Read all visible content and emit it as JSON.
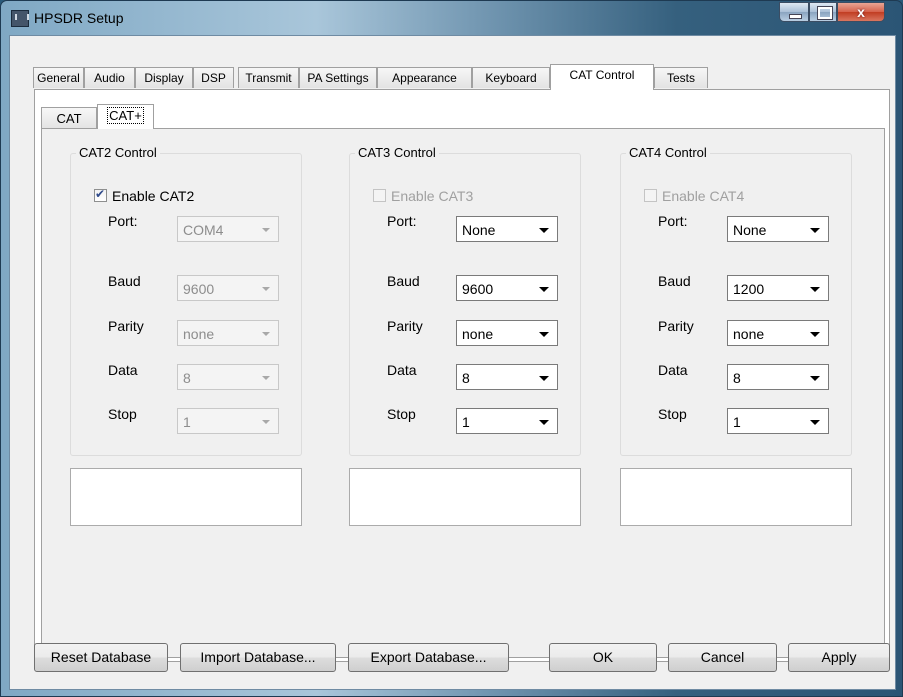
{
  "window": {
    "title": "HPSDR Setup",
    "minimize_symbol": "",
    "close_symbol": "x"
  },
  "tabs": [
    {
      "label": "General"
    },
    {
      "label": "Audio"
    },
    {
      "label": "Display"
    },
    {
      "label": "DSP"
    },
    {
      "label": "Transmit"
    },
    {
      "label": "PA Settings"
    },
    {
      "label": "Appearance"
    },
    {
      "label": "Keyboard"
    },
    {
      "label": "CAT Control",
      "active": true
    },
    {
      "label": "Tests"
    }
  ],
  "subtabs": [
    {
      "label": "CAT"
    },
    {
      "label": "CAT+",
      "active": true
    }
  ],
  "groups": [
    {
      "title": "CAT2 Control",
      "enable_label": "Enable CAT2",
      "enabled": true,
      "checked": true,
      "fields": {
        "port": {
          "label": "Port:",
          "value": "COM4"
        },
        "baud": {
          "label": "Baud",
          "value": "9600"
        },
        "parity": {
          "label": "Parity",
          "value": "none"
        },
        "data": {
          "label": "Data",
          "value": "8"
        },
        "stop": {
          "label": "Stop",
          "value": "1"
        }
      }
    },
    {
      "title": "CAT3 Control",
      "enable_label": "Enable CAT3",
      "enabled": false,
      "checked": false,
      "fields": {
        "port": {
          "label": "Port:",
          "value": "None"
        },
        "baud": {
          "label": "Baud",
          "value": "9600"
        },
        "parity": {
          "label": "Parity",
          "value": "none"
        },
        "data": {
          "label": "Data",
          "value": "8"
        },
        "stop": {
          "label": "Stop",
          "value": "1"
        }
      }
    },
    {
      "title": "CAT4 Control",
      "enable_label": "Enable CAT4",
      "enabled": false,
      "checked": false,
      "fields": {
        "port": {
          "label": "Port:",
          "value": "None"
        },
        "baud": {
          "label": "Baud",
          "value": "1200"
        },
        "parity": {
          "label": "Parity",
          "value": "none"
        },
        "data": {
          "label": "Data",
          "value": "8"
        },
        "stop": {
          "label": "Stop",
          "value": "1"
        }
      }
    }
  ],
  "buttons": {
    "reset": "Reset Database",
    "import": "Import Database...",
    "export": "Export Database...",
    "ok": "OK",
    "cancel": "Cancel",
    "apply": "Apply"
  },
  "colors": {
    "titlebar_glass": "#7fa8c4",
    "close_button": "#c13d22",
    "disabled_text": "#a0a0a0"
  }
}
